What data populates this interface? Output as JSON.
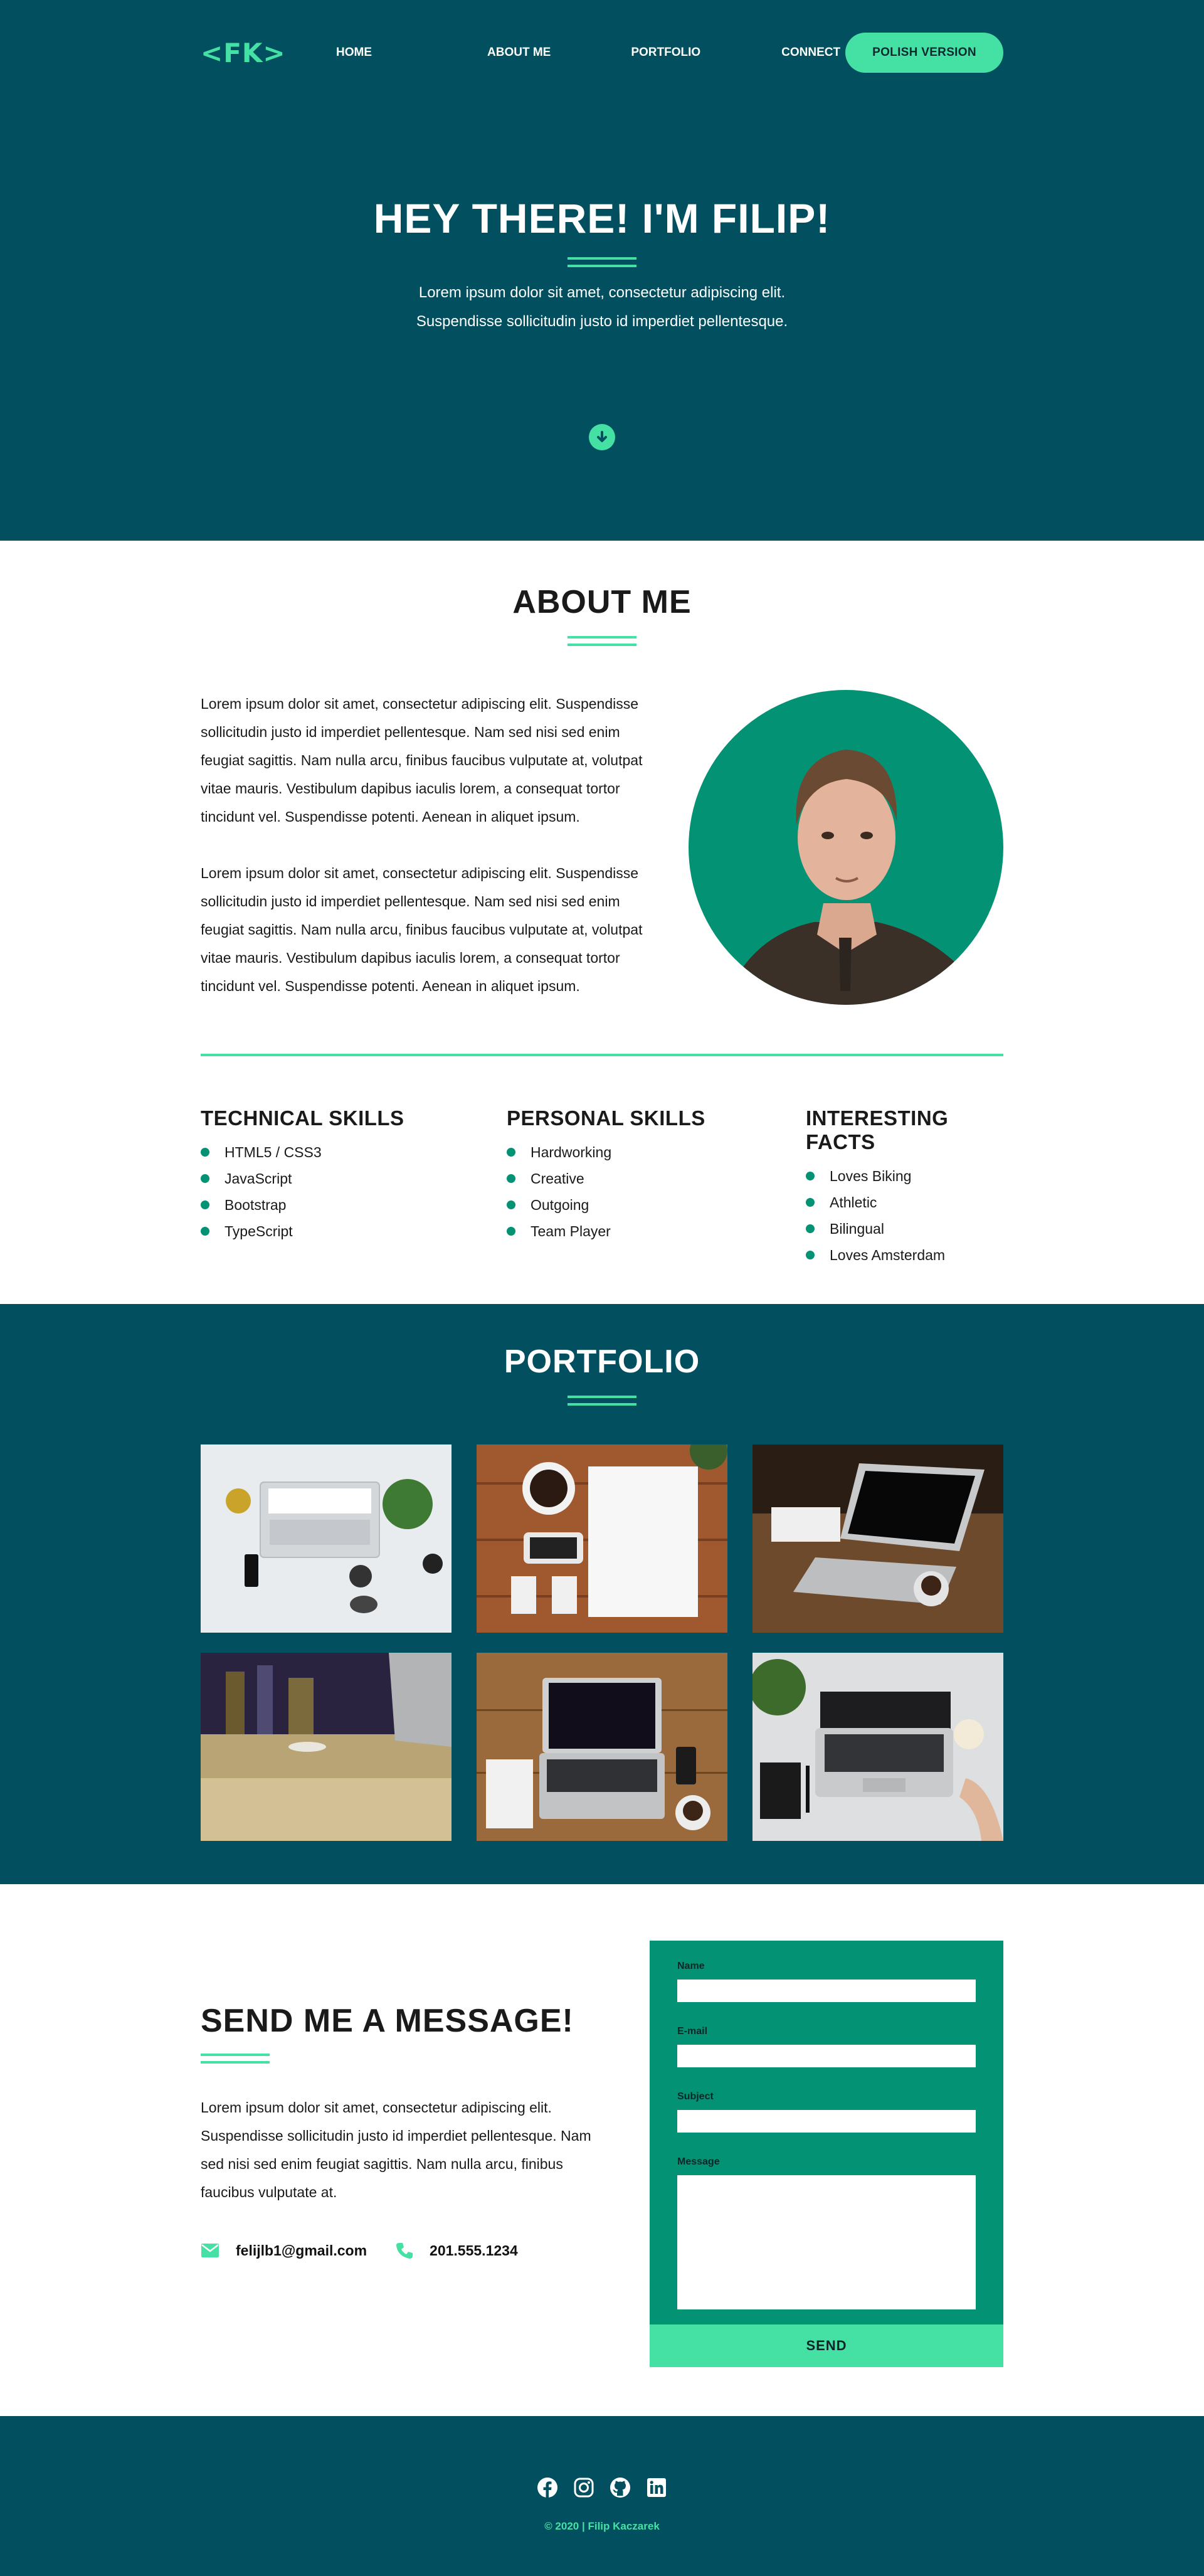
{
  "nav": {
    "logo": "<FK>",
    "links": [
      "HOME",
      "ABOUT ME",
      "PORTFOLIO",
      "CONNECT"
    ],
    "language_button": "POLISH VERSION"
  },
  "hero": {
    "title": "HEY THERE! I'M FILIP!",
    "text_line1": "Lorem ipsum dolor sit amet, consectetur adipiscing elit.",
    "text_line2": "Suspendisse sollicitudin justo id imperdiet pellentesque.",
    "scroll_icon": "arrow-down-circle-icon"
  },
  "about": {
    "title": "ABOUT ME",
    "paragraphs": [
      "Lorem ipsum dolor sit amet, consectetur adipiscing elit. Suspendisse sollicitudin justo id imperdiet pellentesque. Nam sed nisi sed enim feugiat sagittis. Nam nulla arcu, finibus faucibus vulputate at, volutpat vitae mauris. Vestibulum dapibus iaculis lorem, a consequat tortor tincidunt vel. Suspendisse potenti. Aenean in aliquet ipsum.",
      "Lorem ipsum dolor sit amet, consectetur adipiscing elit. Suspendisse sollicitudin justo id imperdiet pellentesque. Nam sed nisi sed enim feugiat sagittis. Nam nulla arcu, finibus faucibus vulputate at, volutpat vitae mauris. Vestibulum dapibus iaculis lorem, a consequat tortor tincidunt vel. Suspendisse potenti. Aenean in aliquet ipsum."
    ],
    "skills": [
      {
        "title": "TECHNICAL SKILLS",
        "items": [
          "HTML5 / CSS3",
          "JavaScript",
          "Bootstrap",
          "TypeScript"
        ]
      },
      {
        "title": "PERSONAL SKILLS",
        "items": [
          "Hardworking",
          "Creative",
          "Outgoing",
          "Team Player"
        ]
      },
      {
        "title": "INTERESTING FACTS",
        "items": [
          "Loves Biking",
          "Athletic",
          "Bilingual",
          "Loves Amsterdam"
        ]
      }
    ]
  },
  "portfolio": {
    "title": "PORTFOLIO"
  },
  "contact": {
    "title": "SEND ME A MESSAGE!",
    "text": "Lorem ipsum dolor sit amet, consectetur adipiscing elit. Suspendisse sollicitudin justo id imperdiet pellentesque. Nam sed nisi sed enim feugiat sagittis. Nam nulla arcu, finibus faucibus vulputate at.",
    "email": "felijlb1@gmail.com",
    "phone": "201.555.1234",
    "form": {
      "name_label": "Name",
      "email_label": "E-mail",
      "subject_label": "Subject",
      "message_label": "Message",
      "send_label": "SEND"
    }
  },
  "footer": {
    "copyright": "© 2020 | Filip Kaczarek",
    "social_icons": [
      "facebook-icon",
      "instagram-icon",
      "github-icon",
      "linkedin-icon"
    ]
  },
  "colors": {
    "dark_teal": "#02505f",
    "accent": "#44e0a4",
    "green": "#039374"
  }
}
